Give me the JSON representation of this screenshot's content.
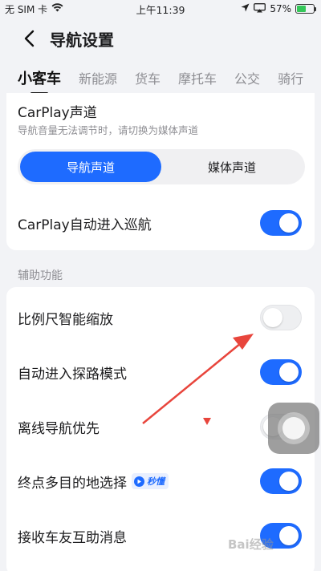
{
  "status_bar": {
    "carrier": "无 SIM 卡",
    "time": "上午11:39",
    "battery": "57%",
    "battery_level": 0.57
  },
  "header": {
    "title": "导航设置"
  },
  "tabs": [
    {
      "label": "小客车",
      "active": true
    },
    {
      "label": "新能源",
      "active": false
    },
    {
      "label": "货车",
      "active": false
    },
    {
      "label": "摩托车",
      "active": false
    },
    {
      "label": "公交",
      "active": false
    },
    {
      "label": "骑行",
      "active": false
    }
  ],
  "carplay_channel": {
    "title": "CarPlay声道",
    "description": "导航音量无法调节时，请切换为媒体声道",
    "options": [
      "导航声道",
      "媒体声道"
    ],
    "selected": "导航声道"
  },
  "carplay_cruise": {
    "label": "CarPlay自动进入巡航",
    "enabled": true
  },
  "assist_section": {
    "title": "辅助功能",
    "items": [
      {
        "label": "比例尺智能缩放",
        "enabled": false
      },
      {
        "label": "自动进入探路模式",
        "enabled": true
      },
      {
        "label": "离线导航优先",
        "enabled": false
      },
      {
        "label": "终点多目的地选择",
        "enabled": true,
        "badge": "秒懂"
      },
      {
        "label": "接收车友互助消息",
        "enabled": true
      }
    ]
  },
  "watermark": "Bai经验",
  "colors": {
    "accent": "#1e6bff",
    "background": "#f2f3f6",
    "arrow": "#e8453c"
  }
}
